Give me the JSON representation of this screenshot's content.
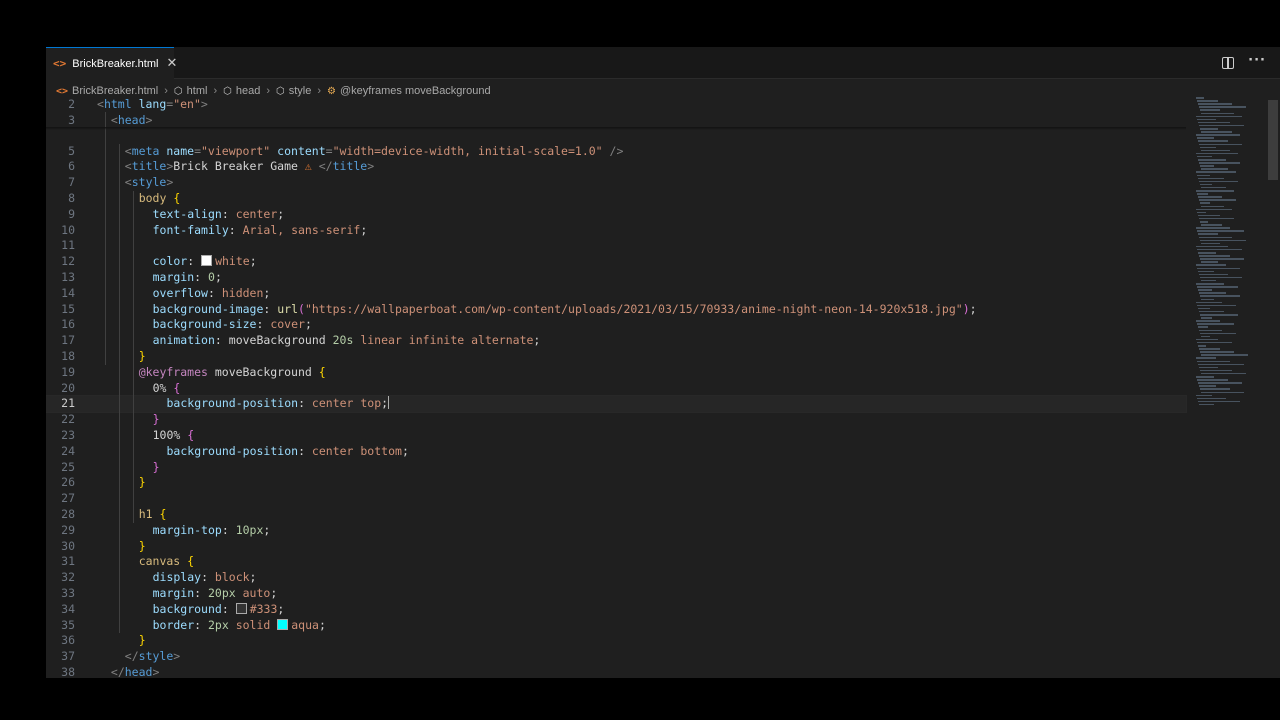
{
  "tab": {
    "label": "BrickBreaker.html",
    "close": "✕"
  },
  "breadcrumb": [
    "BrickBreaker.html",
    "html",
    "head",
    "style",
    "@keyframes moveBackground"
  ],
  "current_line": 21,
  "lines": [
    {
      "n": "2",
      "tokens": [
        [
          "t-punc",
          "<"
        ],
        [
          "t-tag",
          "html "
        ],
        [
          "t-attr",
          "lang"
        ],
        [
          "t-punc",
          "="
        ],
        [
          "t-str",
          "\"en\""
        ],
        [
          "t-punc",
          ">"
        ]
      ],
      "indent": 0
    },
    {
      "n": "3",
      "tokens": [
        [
          "t-punc",
          "<"
        ],
        [
          "t-tag",
          "head"
        ],
        [
          "t-punc",
          ">"
        ]
      ],
      "indent": 1
    },
    {
      "n": "5",
      "tokens": [
        [
          "t-punc",
          "<"
        ],
        [
          "t-tag",
          "meta "
        ],
        [
          "t-attr",
          "name"
        ],
        [
          "t-punc",
          "="
        ],
        [
          "t-str",
          "\"viewport\" "
        ],
        [
          "t-attr",
          "content"
        ],
        [
          "t-punc",
          "="
        ],
        [
          "t-str",
          "\"width=device-width, initial-scale=1.0\" "
        ],
        [
          "t-punc",
          "/>"
        ]
      ],
      "indent": 2
    },
    {
      "n": "6",
      "tokens": [
        [
          "t-punc",
          "<"
        ],
        [
          "t-tag",
          "title"
        ],
        [
          "t-punc",
          ">"
        ],
        [
          "t-text",
          "Brick Breaker Game "
        ],
        [
          "emoji-icon",
          "⚠"
        ],
        [
          "t-text",
          " "
        ],
        [
          "t-punc",
          "</"
        ],
        [
          "t-tag",
          "title"
        ],
        [
          "t-punc",
          ">"
        ]
      ],
      "indent": 2
    },
    {
      "n": "7",
      "tokens": [
        [
          "t-punc",
          "<"
        ],
        [
          "t-tag",
          "style"
        ],
        [
          "t-punc",
          ">"
        ]
      ],
      "indent": 2
    },
    {
      "n": "8",
      "tokens": [
        [
          "t-sel",
          "body "
        ],
        [
          "t-b1",
          "{"
        ]
      ],
      "indent": 3
    },
    {
      "n": "9",
      "tokens": [
        [
          "t-prop",
          "text-align"
        ],
        [
          "t-text",
          ": "
        ],
        [
          "t-str",
          "center"
        ],
        [
          "t-text",
          ";"
        ]
      ],
      "indent": 4
    },
    {
      "n": "10",
      "tokens": [
        [
          "t-prop",
          "font-family"
        ],
        [
          "t-text",
          ": "
        ],
        [
          "t-str",
          "Arial, sans-serif"
        ],
        [
          "t-text",
          ";"
        ]
      ],
      "indent": 4
    },
    {
      "n": "11",
      "tokens": [],
      "indent": 0
    },
    {
      "n": "12",
      "tokens": [
        [
          "t-prop",
          "color"
        ],
        [
          "t-text",
          ": "
        ],
        [
          "swatch",
          "#ffffff"
        ],
        [
          "t-str",
          "white"
        ],
        [
          "t-text",
          ";"
        ]
      ],
      "indent": 4
    },
    {
      "n": "13",
      "tokens": [
        [
          "t-prop",
          "margin"
        ],
        [
          "t-text",
          ": "
        ],
        [
          "t-num",
          "0"
        ],
        [
          "t-text",
          ";"
        ]
      ],
      "indent": 4
    },
    {
      "n": "14",
      "tokens": [
        [
          "t-prop",
          "overflow"
        ],
        [
          "t-text",
          ": "
        ],
        [
          "t-str",
          "hidden"
        ],
        [
          "t-text",
          ";"
        ]
      ],
      "indent": 4
    },
    {
      "n": "15",
      "tokens": [
        [
          "t-prop",
          "background-image"
        ],
        [
          "t-text",
          ": "
        ],
        [
          "t-fn",
          "url"
        ],
        [
          "t-b2",
          "("
        ],
        [
          "t-str",
          "\"https://wallpaperboat.com/wp-content/uploads/2021/03/15/70933/anime-night-neon-14-920x518.jpg\""
        ],
        [
          "t-b2",
          ")"
        ],
        [
          "t-text",
          ";"
        ]
      ],
      "indent": 4
    },
    {
      "n": "16",
      "tokens": [
        [
          "t-prop",
          "background-size"
        ],
        [
          "t-text",
          ": "
        ],
        [
          "t-str",
          "cover"
        ],
        [
          "t-text",
          ";"
        ]
      ],
      "indent": 4
    },
    {
      "n": "17",
      "tokens": [
        [
          "t-prop",
          "animation"
        ],
        [
          "t-text",
          ": "
        ],
        [
          "t-text",
          "moveBackground "
        ],
        [
          "t-num",
          "20s "
        ],
        [
          "t-str",
          "linear infinite alternate"
        ],
        [
          "t-text",
          ";"
        ]
      ],
      "indent": 4
    },
    {
      "n": "18",
      "tokens": [
        [
          "t-b1",
          "}"
        ]
      ],
      "indent": 3
    },
    {
      "n": "19",
      "tokens": [
        [
          "t-at",
          "@keyframes "
        ],
        [
          "t-text",
          "moveBackground "
        ],
        [
          "t-b1",
          "{"
        ]
      ],
      "indent": 3
    },
    {
      "n": "20",
      "tokens": [
        [
          "t-text",
          "0% "
        ],
        [
          "t-b2",
          "{"
        ]
      ],
      "indent": 4
    },
    {
      "n": "21",
      "tokens": [
        [
          "t-prop",
          "background-position"
        ],
        [
          "t-text",
          ": "
        ],
        [
          "t-str",
          "center top"
        ],
        [
          "t-text",
          ";"
        ],
        [
          "cursor",
          ""
        ]
      ],
      "indent": 5
    },
    {
      "n": "22",
      "tokens": [
        [
          "t-b2",
          "}"
        ]
      ],
      "indent": 4
    },
    {
      "n": "23",
      "tokens": [
        [
          "t-text",
          "100% "
        ],
        [
          "t-b2",
          "{"
        ]
      ],
      "indent": 4
    },
    {
      "n": "24",
      "tokens": [
        [
          "t-prop",
          "background-position"
        ],
        [
          "t-text",
          ": "
        ],
        [
          "t-str",
          "center bottom"
        ],
        [
          "t-text",
          ";"
        ]
      ],
      "indent": 5
    },
    {
      "n": "25",
      "tokens": [
        [
          "t-b2",
          "}"
        ]
      ],
      "indent": 4
    },
    {
      "n": "26",
      "tokens": [
        [
          "t-b1",
          "}"
        ]
      ],
      "indent": 3
    },
    {
      "n": "27",
      "tokens": [],
      "indent": 0
    },
    {
      "n": "28",
      "tokens": [
        [
          "t-sel",
          "h1 "
        ],
        [
          "t-b1",
          "{"
        ]
      ],
      "indent": 3
    },
    {
      "n": "29",
      "tokens": [
        [
          "t-prop",
          "margin-top"
        ],
        [
          "t-text",
          ": "
        ],
        [
          "t-num",
          "10px"
        ],
        [
          "t-text",
          ";"
        ]
      ],
      "indent": 4
    },
    {
      "n": "30",
      "tokens": [
        [
          "t-b1",
          "}"
        ]
      ],
      "indent": 3
    },
    {
      "n": "31",
      "tokens": [
        [
          "t-sel",
          "canvas "
        ],
        [
          "t-b1",
          "{"
        ]
      ],
      "indent": 3
    },
    {
      "n": "32",
      "tokens": [
        [
          "t-prop",
          "display"
        ],
        [
          "t-text",
          ": "
        ],
        [
          "t-str",
          "block"
        ],
        [
          "t-text",
          ";"
        ]
      ],
      "indent": 4
    },
    {
      "n": "33",
      "tokens": [
        [
          "t-prop",
          "margin"
        ],
        [
          "t-text",
          ": "
        ],
        [
          "t-num",
          "20px "
        ],
        [
          "t-str",
          "auto"
        ],
        [
          "t-text",
          ";"
        ]
      ],
      "indent": 4
    },
    {
      "n": "34",
      "tokens": [
        [
          "t-prop",
          "background"
        ],
        [
          "t-text",
          ": "
        ],
        [
          "swatch",
          "#333333"
        ],
        [
          "t-str",
          "#333"
        ],
        [
          "t-text",
          ";"
        ]
      ],
      "indent": 4
    },
    {
      "n": "35",
      "tokens": [
        [
          "t-prop",
          "border"
        ],
        [
          "t-text",
          ": "
        ],
        [
          "t-num",
          "2px "
        ],
        [
          "t-str",
          "solid "
        ],
        [
          "swatch",
          "#00ffff"
        ],
        [
          "t-str",
          "aqua"
        ],
        [
          "t-text",
          ";"
        ]
      ],
      "indent": 4
    },
    {
      "n": "36",
      "tokens": [
        [
          "t-b1",
          "}"
        ]
      ],
      "indent": 3
    },
    {
      "n": "37",
      "tokens": [
        [
          "t-punc",
          "</"
        ],
        [
          "t-tag",
          "style"
        ],
        [
          "t-punc",
          ">"
        ]
      ],
      "indent": 2
    },
    {
      "n": "38",
      "tokens": [
        [
          "t-punc",
          "</"
        ],
        [
          "t-tag",
          "head"
        ],
        [
          "t-punc",
          ">"
        ]
      ],
      "indent": 1
    }
  ]
}
